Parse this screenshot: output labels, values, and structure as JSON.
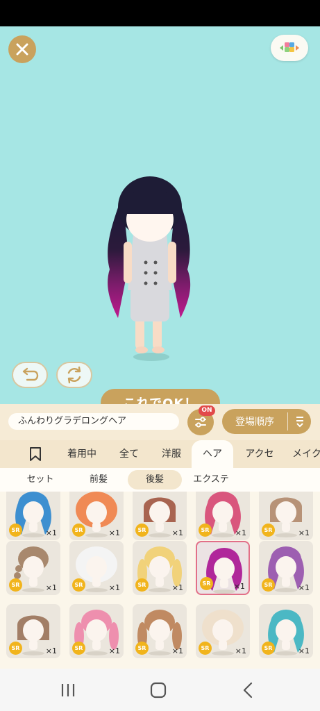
{
  "header": {
    "close_icon": "close-x-icon",
    "palette_icon": "color-palette-icon"
  },
  "actions": {
    "undo_icon": "undo-icon",
    "rotate_icon": "rotate-icon",
    "ok_label": "これでOK！"
  },
  "info": {
    "item_name": "ふんわりグラデロングヘア",
    "filter_badge": "ON",
    "sort_label": "登場順序"
  },
  "category_tabs": [
    {
      "label": "",
      "icon": "bookmark-icon"
    },
    {
      "label": "着用中"
    },
    {
      "label": "全て"
    },
    {
      "label": "洋服"
    },
    {
      "label": "ヘア",
      "active": true
    },
    {
      "label": "アクセ"
    },
    {
      "label": "メイク"
    }
  ],
  "sub_tabs": [
    {
      "label": "セット"
    },
    {
      "label": "前髪"
    },
    {
      "label": "後髪",
      "active": true
    },
    {
      "label": "エクステ"
    }
  ],
  "items": [
    {
      "rarity": "SR",
      "qty": "×1",
      "hair": "#3d8fd0",
      "style": "long-wavy"
    },
    {
      "rarity": "SR",
      "qty": "×1",
      "hair": "#f08a55",
      "style": "puffy"
    },
    {
      "rarity": "SR",
      "qty": "×1",
      "hair": "#a86450",
      "style": "bob"
    },
    {
      "rarity": "SR",
      "qty": "×1",
      "hair": "#d9567d",
      "style": "long-wavy"
    },
    {
      "rarity": "SR",
      "qty": "×1",
      "hair": "#b79277",
      "style": "bob"
    },
    {
      "rarity": "SR",
      "qty": "×1",
      "hair": "#a8886d",
      "style": "braid"
    },
    {
      "rarity": "SR",
      "qty": "×1",
      "hair": "#f4f4f4",
      "style": "puffy"
    },
    {
      "rarity": "SR",
      "qty": "×1",
      "hair": "#f1d27a",
      "style": "twin"
    },
    {
      "rarity": "SR",
      "qty": "×1",
      "hair": "#b0279a",
      "style": "long-wavy",
      "selected": true
    },
    {
      "rarity": "SR",
      "qty": "×1",
      "hair": "#9d5fb1",
      "style": "long-wavy"
    },
    {
      "rarity": "SR",
      "qty": "×1",
      "hair": "#a27e66",
      "style": "bob"
    },
    {
      "rarity": "SR",
      "qty": "×1",
      "hair": "#ee8fae",
      "style": "twin"
    },
    {
      "rarity": "SR",
      "qty": "×1",
      "hair": "#c08a62",
      "style": "twin"
    },
    {
      "rarity": "SR",
      "qty": "×1",
      "hair": "#efe0cc",
      "style": "puffy"
    },
    {
      "rarity": "SR",
      "qty": "×1",
      "hair": "#4bb8c4",
      "style": "long-wavy"
    }
  ],
  "navbar": {
    "recents_icon": "recent-apps-icon",
    "home_icon": "home-icon",
    "back_icon": "back-icon"
  }
}
